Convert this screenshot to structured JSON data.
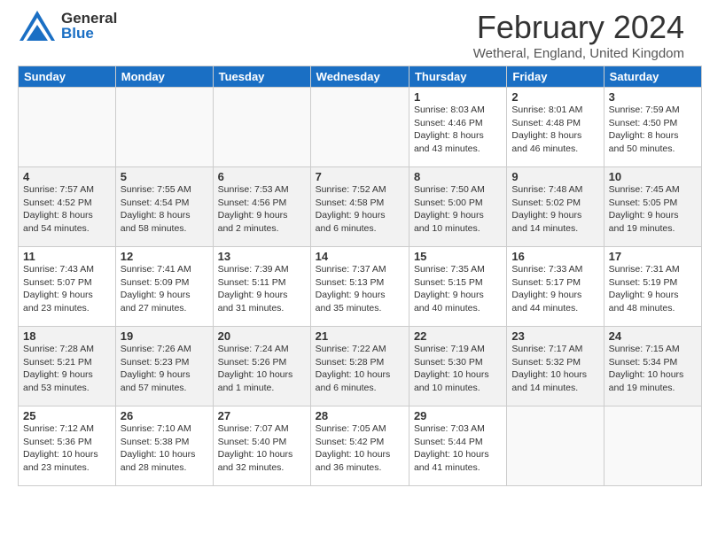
{
  "app": {
    "logo_general": "General",
    "logo_blue": "Blue",
    "month_title": "February 2024",
    "location": "Wetheral, England, United Kingdom"
  },
  "calendar": {
    "days_of_week": [
      "Sunday",
      "Monday",
      "Tuesday",
      "Wednesday",
      "Thursday",
      "Friday",
      "Saturday"
    ],
    "weeks": [
      [
        {
          "day": "",
          "info": ""
        },
        {
          "day": "",
          "info": ""
        },
        {
          "day": "",
          "info": ""
        },
        {
          "day": "",
          "info": ""
        },
        {
          "day": "1",
          "info": "Sunrise: 8:03 AM\nSunset: 4:46 PM\nDaylight: 8 hours\nand 43 minutes."
        },
        {
          "day": "2",
          "info": "Sunrise: 8:01 AM\nSunset: 4:48 PM\nDaylight: 8 hours\nand 46 minutes."
        },
        {
          "day": "3",
          "info": "Sunrise: 7:59 AM\nSunset: 4:50 PM\nDaylight: 8 hours\nand 50 minutes."
        }
      ],
      [
        {
          "day": "4",
          "info": "Sunrise: 7:57 AM\nSunset: 4:52 PM\nDaylight: 8 hours\nand 54 minutes."
        },
        {
          "day": "5",
          "info": "Sunrise: 7:55 AM\nSunset: 4:54 PM\nDaylight: 8 hours\nand 58 minutes."
        },
        {
          "day": "6",
          "info": "Sunrise: 7:53 AM\nSunset: 4:56 PM\nDaylight: 9 hours\nand 2 minutes."
        },
        {
          "day": "7",
          "info": "Sunrise: 7:52 AM\nSunset: 4:58 PM\nDaylight: 9 hours\nand 6 minutes."
        },
        {
          "day": "8",
          "info": "Sunrise: 7:50 AM\nSunset: 5:00 PM\nDaylight: 9 hours\nand 10 minutes."
        },
        {
          "day": "9",
          "info": "Sunrise: 7:48 AM\nSunset: 5:02 PM\nDaylight: 9 hours\nand 14 minutes."
        },
        {
          "day": "10",
          "info": "Sunrise: 7:45 AM\nSunset: 5:05 PM\nDaylight: 9 hours\nand 19 minutes."
        }
      ],
      [
        {
          "day": "11",
          "info": "Sunrise: 7:43 AM\nSunset: 5:07 PM\nDaylight: 9 hours\nand 23 minutes."
        },
        {
          "day": "12",
          "info": "Sunrise: 7:41 AM\nSunset: 5:09 PM\nDaylight: 9 hours\nand 27 minutes."
        },
        {
          "day": "13",
          "info": "Sunrise: 7:39 AM\nSunset: 5:11 PM\nDaylight: 9 hours\nand 31 minutes."
        },
        {
          "day": "14",
          "info": "Sunrise: 7:37 AM\nSunset: 5:13 PM\nDaylight: 9 hours\nand 35 minutes."
        },
        {
          "day": "15",
          "info": "Sunrise: 7:35 AM\nSunset: 5:15 PM\nDaylight: 9 hours\nand 40 minutes."
        },
        {
          "day": "16",
          "info": "Sunrise: 7:33 AM\nSunset: 5:17 PM\nDaylight: 9 hours\nand 44 minutes."
        },
        {
          "day": "17",
          "info": "Sunrise: 7:31 AM\nSunset: 5:19 PM\nDaylight: 9 hours\nand 48 minutes."
        }
      ],
      [
        {
          "day": "18",
          "info": "Sunrise: 7:28 AM\nSunset: 5:21 PM\nDaylight: 9 hours\nand 53 minutes."
        },
        {
          "day": "19",
          "info": "Sunrise: 7:26 AM\nSunset: 5:23 PM\nDaylight: 9 hours\nand 57 minutes."
        },
        {
          "day": "20",
          "info": "Sunrise: 7:24 AM\nSunset: 5:26 PM\nDaylight: 10 hours\nand 1 minute."
        },
        {
          "day": "21",
          "info": "Sunrise: 7:22 AM\nSunset: 5:28 PM\nDaylight: 10 hours\nand 6 minutes."
        },
        {
          "day": "22",
          "info": "Sunrise: 7:19 AM\nSunset: 5:30 PM\nDaylight: 10 hours\nand 10 minutes."
        },
        {
          "day": "23",
          "info": "Sunrise: 7:17 AM\nSunset: 5:32 PM\nDaylight: 10 hours\nand 14 minutes."
        },
        {
          "day": "24",
          "info": "Sunrise: 7:15 AM\nSunset: 5:34 PM\nDaylight: 10 hours\nand 19 minutes."
        }
      ],
      [
        {
          "day": "25",
          "info": "Sunrise: 7:12 AM\nSunset: 5:36 PM\nDaylight: 10 hours\nand 23 minutes."
        },
        {
          "day": "26",
          "info": "Sunrise: 7:10 AM\nSunset: 5:38 PM\nDaylight: 10 hours\nand 28 minutes."
        },
        {
          "day": "27",
          "info": "Sunrise: 7:07 AM\nSunset: 5:40 PM\nDaylight: 10 hours\nand 32 minutes."
        },
        {
          "day": "28",
          "info": "Sunrise: 7:05 AM\nSunset: 5:42 PM\nDaylight: 10 hours\nand 36 minutes."
        },
        {
          "day": "29",
          "info": "Sunrise: 7:03 AM\nSunset: 5:44 PM\nDaylight: 10 hours\nand 41 minutes."
        },
        {
          "day": "",
          "info": ""
        },
        {
          "day": "",
          "info": ""
        }
      ]
    ]
  }
}
